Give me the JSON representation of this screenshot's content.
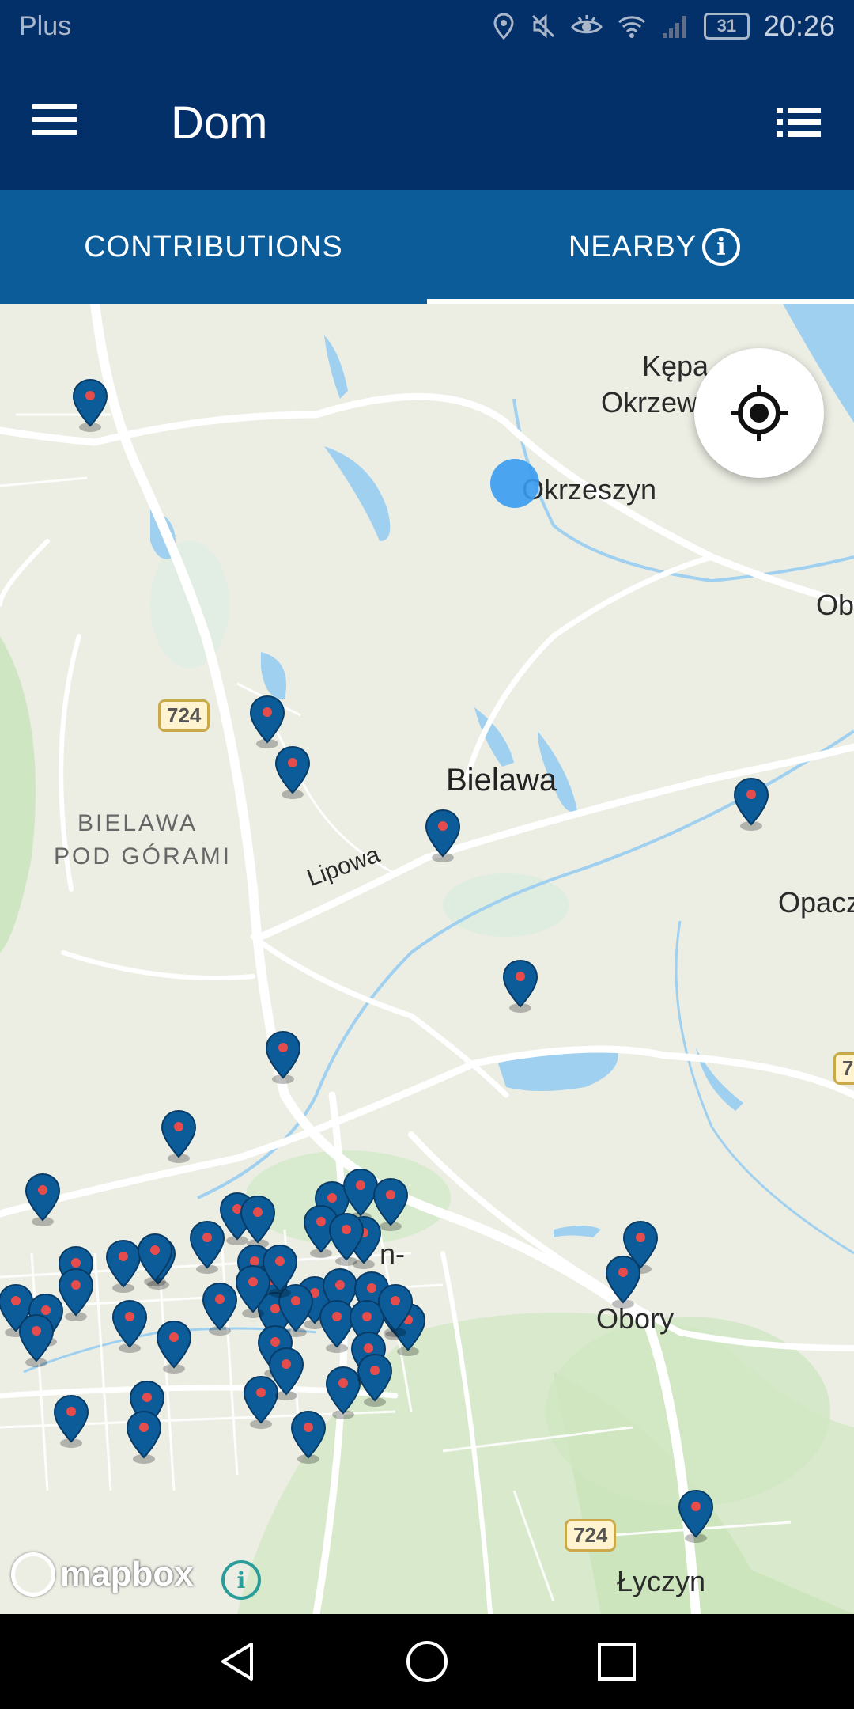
{
  "status_bar": {
    "carrier": "Plus",
    "battery": "31",
    "time": "20:26",
    "icons": [
      "location-icon",
      "mute-icon",
      "eye-icon",
      "wifi-icon",
      "signal-icon",
      "battery-icon"
    ]
  },
  "toolbar": {
    "title": "Dom",
    "menu_icon": "hamburger-menu-icon",
    "list_icon": "list-view-icon"
  },
  "tabs": [
    {
      "label": "CONTRIBUTIONS",
      "selected": false
    },
    {
      "label": "NEARBY",
      "selected": true
    }
  ],
  "map": {
    "places": {
      "kepa": "Kępa",
      "okrzew": "Okrzew",
      "okrzeszyn": "Okrzeszyn",
      "ob": "Ob",
      "bielawa": "Bielawa",
      "bielawa_pod_gorami_1": "BIELAWA",
      "bielawa_pod_gorami_2": "POD GÓRAMI",
      "lipowa": "Lipowa",
      "opacz": "Opacz",
      "obory": "Obory",
      "lyczyn": "Łyczyn",
      "konstancin": "n-"
    },
    "road_numbers": [
      "724",
      "724",
      "7"
    ],
    "attribution": "mapbox",
    "colors": {
      "water": "#9fd0f0",
      "green": "#cfe6c2",
      "road": "#ffffff",
      "pin": "#0d5c9a",
      "pin_dot": "#e74c4c",
      "user_location": "#3a9bf0"
    }
  },
  "colors": {
    "primary_dark": "#04306a",
    "primary": "#0d5c9a"
  }
}
